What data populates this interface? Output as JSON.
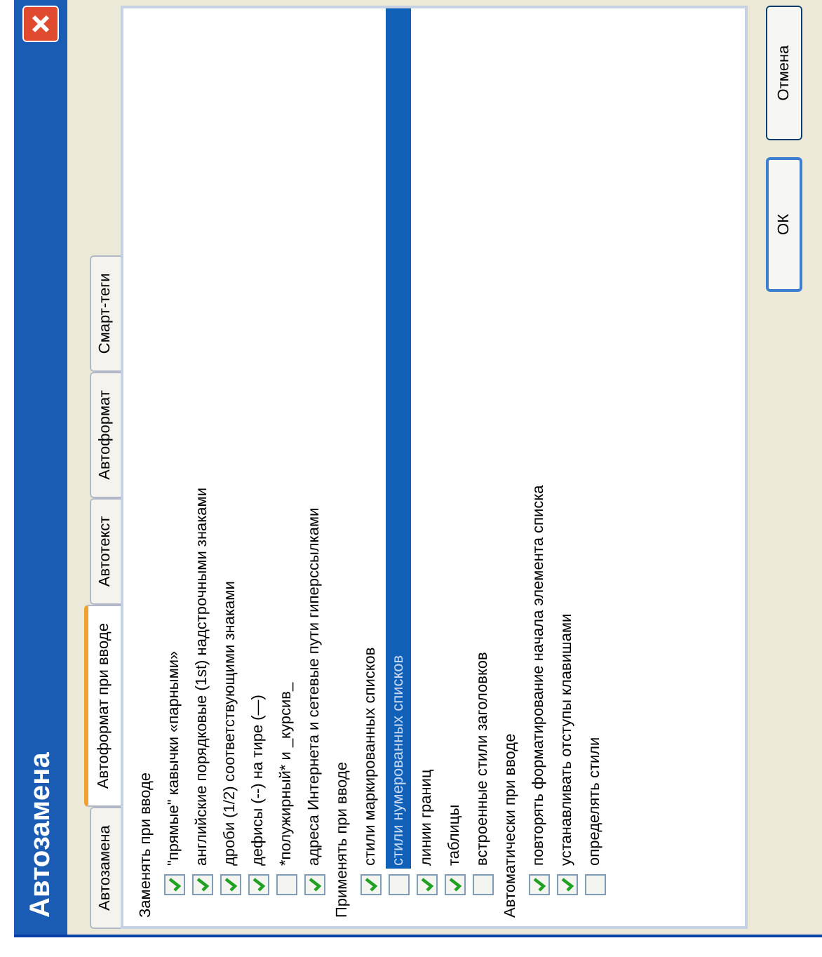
{
  "window": {
    "title": "Автозамена"
  },
  "tabs": [
    {
      "label": "Автозамена",
      "selected": false
    },
    {
      "label": "Автоформат при вводе",
      "selected": true
    },
    {
      "label": "Автотекст",
      "selected": false
    },
    {
      "label": "Автоформат",
      "selected": false
    },
    {
      "label": "Смарт-теги",
      "selected": false
    }
  ],
  "options": [
    {
      "kind": "heading",
      "label": "Заменять при вводе"
    },
    {
      "kind": "checkbox",
      "label": "\"прямые\" кавычки «парными»",
      "checked": true,
      "selected": false
    },
    {
      "kind": "checkbox",
      "label": "английские порядковые (1st) надстрочными знаками",
      "checked": true,
      "selected": false
    },
    {
      "kind": "checkbox",
      "label": "дроби (1/2) соответствующими знаками",
      "checked": true,
      "selected": false
    },
    {
      "kind": "checkbox",
      "label": "дефисы (--) на тире (—)",
      "checked": true,
      "selected": false
    },
    {
      "kind": "checkbox",
      "label": "*полужирный* и _курсив_",
      "checked": false,
      "selected": false
    },
    {
      "kind": "checkbox",
      "label": "адреса Интернета и сетевые пути гиперссылками",
      "checked": true,
      "selected": false
    },
    {
      "kind": "heading",
      "label": "Применять при вводе"
    },
    {
      "kind": "checkbox",
      "label": "стили маркированных списков",
      "checked": true,
      "selected": false
    },
    {
      "kind": "checkbox",
      "label": "стили нумерованных списков",
      "checked": false,
      "selected": true
    },
    {
      "kind": "checkbox",
      "label": "линии границ",
      "checked": true,
      "selected": false
    },
    {
      "kind": "checkbox",
      "label": "таблицы",
      "checked": true,
      "selected": false
    },
    {
      "kind": "checkbox",
      "label": "встроенные стили заголовков",
      "checked": false,
      "selected": false
    },
    {
      "kind": "heading",
      "label": "Автоматически при вводе"
    },
    {
      "kind": "checkbox",
      "label": "повторять форматирование начала элемента списка",
      "checked": true,
      "selected": false
    },
    {
      "kind": "checkbox",
      "label": "устанавливать отступы клавишами",
      "checked": true,
      "selected": false
    },
    {
      "kind": "checkbox",
      "label": "определять стили",
      "checked": false,
      "selected": false
    }
  ],
  "buttons": [
    "ОК",
    "Отмена"
  ]
}
